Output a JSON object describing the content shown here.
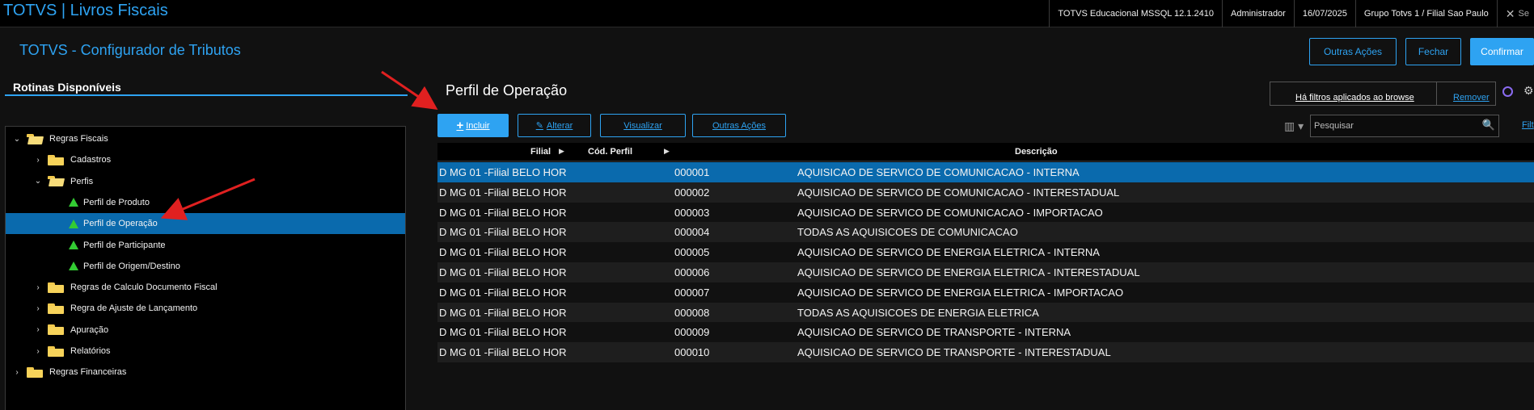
{
  "topbar": {
    "app_title": "TOTVS | Livros Fiscais",
    "status": [
      "TOTVS Educacional MSSQL 12.1.2410",
      "Administrador",
      "16/07/2025",
      "Grupo Totvs 1 / Filial Sao Paulo"
    ],
    "close_text": "Se"
  },
  "header": {
    "title": "TOTVS - Configurador de Tributos",
    "btn_outras": "Outras Ações",
    "btn_fechar": "Fechar",
    "btn_confirmar": "Confirmar"
  },
  "left": {
    "heading": "Rotinas Disponíveis",
    "tree": [
      {
        "label": "Regras Fiscais",
        "level": 0,
        "type": "folder-open",
        "chevron": "v"
      },
      {
        "label": "Cadastros",
        "level": 1,
        "type": "folder",
        "chevron": ">"
      },
      {
        "label": "Perfis",
        "level": 1,
        "type": "folder-open",
        "chevron": "v"
      },
      {
        "label": "Perfil de Produto",
        "level": 2,
        "type": "leaf",
        "chevron": ""
      },
      {
        "label": "Perfil de Operação",
        "level": 2,
        "type": "leaf",
        "chevron": "",
        "selected": true
      },
      {
        "label": "Perfil de Participante",
        "level": 2,
        "type": "leaf",
        "chevron": ""
      },
      {
        "label": "Perfil de Origem/Destino",
        "level": 2,
        "type": "leaf",
        "chevron": ""
      },
      {
        "label": "Regras de Calculo Documento Fiscal",
        "level": 1,
        "type": "folder",
        "chevron": ">"
      },
      {
        "label": "Regra de Ajuste de Lançamento",
        "level": 1,
        "type": "folder",
        "chevron": ">"
      },
      {
        "label": "Apuração",
        "level": 1,
        "type": "folder",
        "chevron": ">"
      },
      {
        "label": "Relatórios",
        "level": 1,
        "type": "folder",
        "chevron": ">"
      },
      {
        "label": "Regras Financeiras",
        "level": 0,
        "type": "folder",
        "chevron": ">"
      }
    ]
  },
  "main": {
    "title": "Perfil de Operação",
    "filter_message": "Há filtros aplicados ao browse",
    "filter_remove": "Remover",
    "actions": {
      "incluir": "Incluir",
      "alterar": "Alterar",
      "visualizar": "Visualizar",
      "outras": "Outras Ações"
    },
    "search_placeholder": "Pesquisar",
    "filter_link": "Filt",
    "columns": [
      "Filial",
      "Cód. Perfil",
      "Descrição"
    ],
    "rows": [
      [
        "D MG 01 -Filial BELO HOR",
        "000001",
        "AQUISICAO DE SERVICO DE COMUNICACAO - INTERNA"
      ],
      [
        "D MG 01 -Filial BELO HOR",
        "000002",
        "AQUISICAO DE SERVICO DE COMUNICACAO - INTERESTADUAL"
      ],
      [
        "D MG 01 -Filial BELO HOR",
        "000003",
        "AQUISICAO DE SERVICO DE COMUNICACAO - IMPORTACAO"
      ],
      [
        "D MG 01 -Filial BELO HOR",
        "000004",
        "TODAS AS AQUISICOES DE COMUNICACAO"
      ],
      [
        "D MG 01 -Filial BELO HOR",
        "000005",
        "AQUISICAO DE SERVICO DE ENERGIA ELETRICA - INTERNA"
      ],
      [
        "D MG 01 -Filial BELO HOR",
        "000006",
        "AQUISICAO DE SERVICO DE ENERGIA ELETRICA - INTERESTADUAL"
      ],
      [
        "D MG 01 -Filial BELO HOR",
        "000007",
        "AQUISICAO DE SERVICO DE ENERGIA ELETRICA - IMPORTACAO"
      ],
      [
        "D MG 01 -Filial BELO HOR",
        "000008",
        "TODAS AS AQUISICOES DE ENERGIA ELETRICA"
      ],
      [
        "D MG 01 -Filial BELO HOR",
        "000009",
        "AQUISICAO DE SERVICO DE TRANSPORTE - INTERNA"
      ],
      [
        "D MG 01 -Filial BELO HOR",
        "000010",
        "AQUISICAO DE SERVICO DE TRANSPORTE - INTERESTADUAL"
      ]
    ]
  },
  "colors": {
    "accent": "#2ea3f2",
    "selection": "#0a6aad",
    "annotation_arrow": "#e02020"
  }
}
